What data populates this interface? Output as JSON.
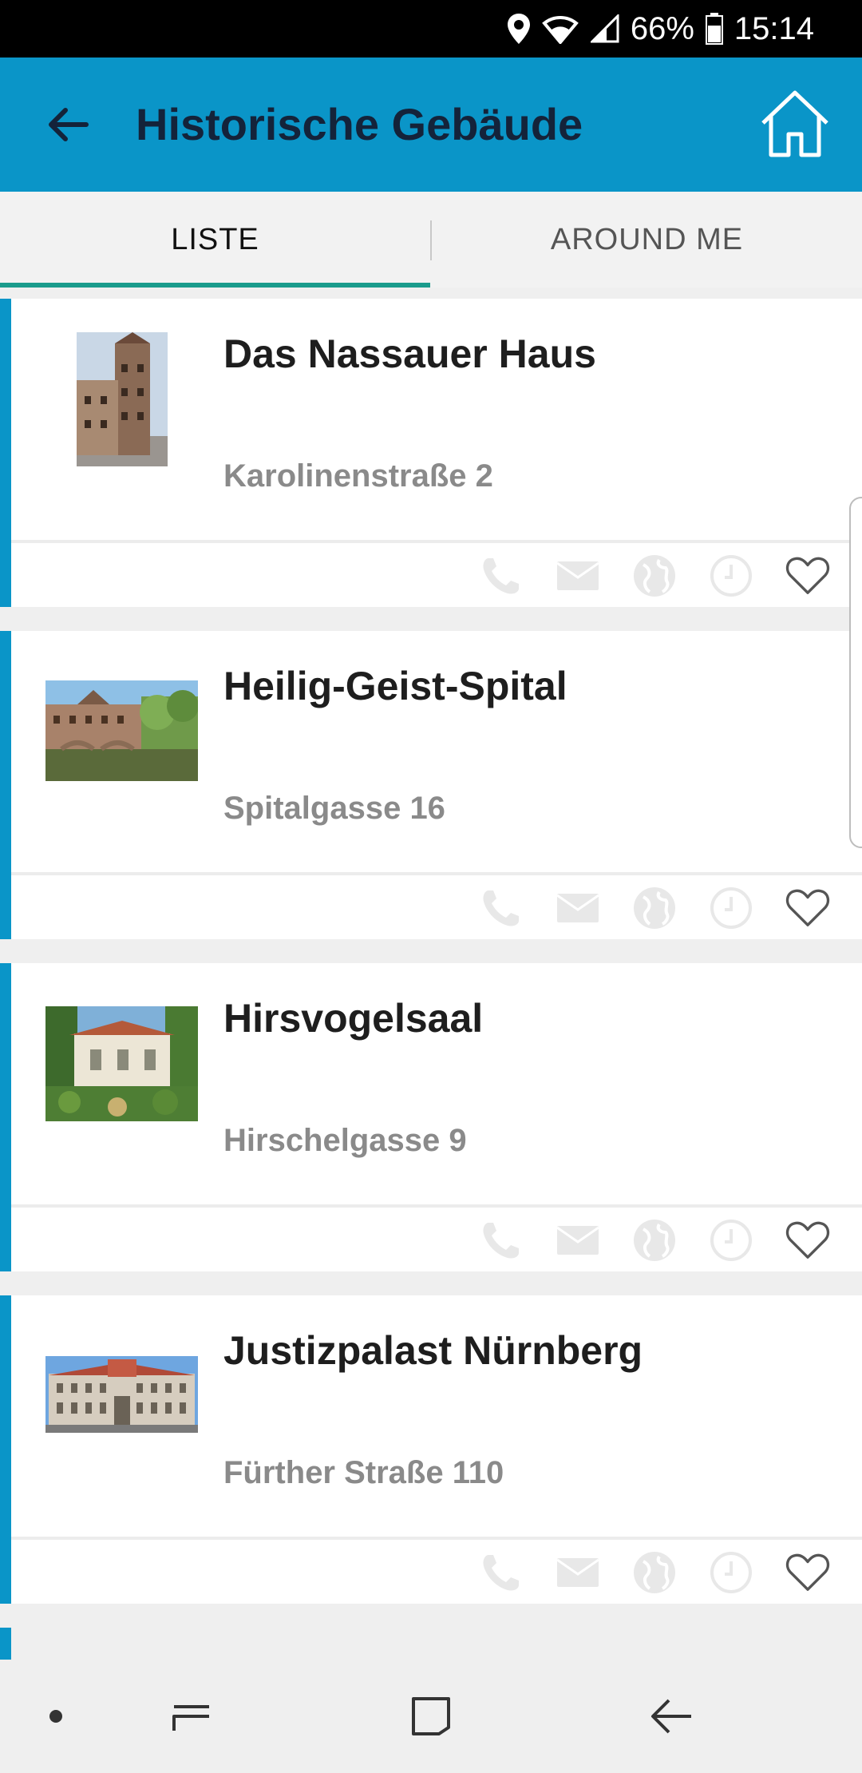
{
  "status_bar": {
    "battery": "66%",
    "time": "15:14",
    "icons": [
      "location-icon",
      "wifi-icon",
      "signal-icon",
      "battery-icon"
    ]
  },
  "app_bar": {
    "title": "Historische Gebäude",
    "back_icon": "arrow-left-icon",
    "home_icon": "home-icon",
    "background": "#0a95c8"
  },
  "tabs": [
    {
      "label": "LISTE",
      "selected": true
    },
    {
      "label": "AROUND ME",
      "selected": false
    }
  ],
  "accent_color": "#1a9b8c",
  "items": [
    {
      "name": "Das Nassauer Haus",
      "address": "Karolinenstraße 2",
      "image": "tower-house-photo"
    },
    {
      "name": "Heilig-Geist-Spital",
      "address": "Spitalgasse 16",
      "image": "river-building-photo"
    },
    {
      "name": "Hirsvogelsaal",
      "address": "Hirschelgasse 9",
      "image": "garden-hall-photo"
    },
    {
      "name": "Justizpalast Nürnberg",
      "address": "Fürther Straße 110",
      "image": "palace-photo"
    }
  ],
  "item_actions": [
    "phone-icon",
    "mail-icon",
    "globe-icon",
    "clock-icon",
    "heart-icon"
  ],
  "nav_bar": [
    "dot-icon",
    "recent-apps-icon",
    "home-square-icon",
    "back-icon"
  ]
}
